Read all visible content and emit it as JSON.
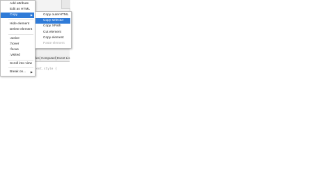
{
  "context_menu": {
    "items": [
      {
        "label": "Add attribute"
      },
      {
        "label": "Edit as HTML"
      },
      {
        "label": "Copy",
        "has_submenu": true,
        "highlighted": true
      },
      {
        "label": "Hide element"
      },
      {
        "label": "Delete element"
      },
      {
        "label": ":active"
      },
      {
        "label": ":hover"
      },
      {
        "label": ":focus"
      },
      {
        "label": ":visited"
      },
      {
        "label": "Scroll into view"
      },
      {
        "label": "Break on...",
        "has_submenu": true
      }
    ],
    "arrow_glyph": "▶"
  },
  "copy_submenu": {
    "items": [
      {
        "label": "Copy outerHTML"
      },
      {
        "label": "Copy selector",
        "highlighted": true
      },
      {
        "label": "Copy XPath"
      },
      {
        "label": "Cut element"
      },
      {
        "label": "Copy element"
      },
      {
        "label": "Paste element",
        "disabled": true
      }
    ]
  },
  "devtools": {
    "tabs": [
      {
        "label": "les"
      },
      {
        "label": "Computed"
      },
      {
        "label": "Event Lis"
      }
    ],
    "styles_fragment": "ent.style {"
  },
  "colors": {
    "highlight": "#2f7bd8",
    "accent_bar": "#2a6fd6"
  }
}
